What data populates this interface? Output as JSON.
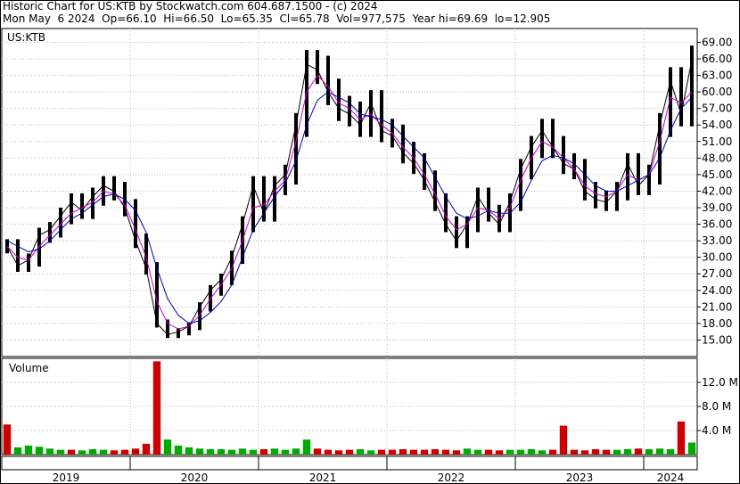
{
  "header": {
    "line1": "Historic Chart for US:KTB by Stockwatch.com 604.687.1500 - (c) 2024",
    "line2": "Mon May  6 2024  Op=66.10  Hi=66.50  Lo=65.35  Cl=65.78  Vol=977,575  Year hi=69.69  lo=12.905"
  },
  "chart_data": [
    {
      "type": "line",
      "subtype": "ohlc-price",
      "title": "US:KTB",
      "xlabel": "",
      "ylabel": "",
      "ylim": [
        12.905,
        69.69
      ],
      "y_ticks": [
        "69.00",
        "66.00",
        "63.00",
        "60.00",
        "57.00",
        "54.00",
        "51.00",
        "48.00",
        "45.00",
        "42.00",
        "39.00",
        "36.00",
        "33.00",
        "30.00",
        "27.00",
        "24.00",
        "21.00",
        "18.00",
        "15.00"
      ],
      "x_ticks": [
        "2019",
        "2020",
        "2021",
        "2022",
        "2023",
        "2024"
      ],
      "grid": true,
      "colors": {
        "price": "#000000",
        "ma_short": "#cc00cc",
        "ma_long": "#0000aa"
      },
      "x": [
        "2019-01",
        "2019-02",
        "2019-03",
        "2019-04",
        "2019-05",
        "2019-06",
        "2019-07",
        "2019-08",
        "2019-09",
        "2019-10",
        "2019-11",
        "2019-12",
        "2020-01",
        "2020-02",
        "2020-03",
        "2020-04",
        "2020-05",
        "2020-06",
        "2020-07",
        "2020-08",
        "2020-09",
        "2020-10",
        "2020-11",
        "2020-12",
        "2021-01",
        "2021-02",
        "2021-03",
        "2021-04",
        "2021-05",
        "2021-06",
        "2021-07",
        "2021-08",
        "2021-09",
        "2021-10",
        "2021-11",
        "2021-12",
        "2022-01",
        "2022-02",
        "2022-03",
        "2022-04",
        "2022-05",
        "2022-06",
        "2022-07",
        "2022-08",
        "2022-09",
        "2022-10",
        "2022-11",
        "2022-12",
        "2023-01",
        "2023-02",
        "2023-03",
        "2023-04",
        "2023-05",
        "2023-06",
        "2023-07",
        "2023-08",
        "2023-09",
        "2023-10",
        "2023-11",
        "2023-12",
        "2024-01",
        "2024-02",
        "2024-03",
        "2024-04",
        "2024-05"
      ],
      "series": [
        {
          "values": [
            32,
            28.5,
            29.5,
            34,
            35,
            37.5,
            40,
            38.5,
            41,
            43,
            42,
            39,
            33,
            28,
            18,
            16,
            16.5,
            17.5,
            21,
            24,
            26,
            30,
            36,
            43,
            38,
            43,
            45,
            54,
            65,
            64,
            60,
            57,
            56,
            54,
            58,
            53,
            52,
            49,
            47,
            44,
            40,
            36,
            33,
            36,
            41,
            38,
            36,
            40,
            46,
            50,
            53,
            50,
            47,
            46,
            42,
            40.5,
            40,
            42,
            47,
            43,
            45,
            54,
            62,
            56,
            65.78
          ]
        },
        {
          "values": [
            32,
            30,
            29.5,
            32,
            34,
            36,
            38,
            39,
            40,
            42,
            41.5,
            39.5,
            35,
            30,
            22,
            18,
            17,
            17.5,
            19.5,
            22.5,
            25,
            28,
            33,
            39,
            39.5,
            42,
            44,
            51,
            60,
            63,
            61,
            58,
            57,
            55,
            56,
            54,
            52.5,
            50,
            48,
            45,
            41.5,
            37.5,
            35,
            36,
            39,
            38.5,
            37,
            39,
            44,
            48,
            51,
            50,
            48,
            46,
            43,
            41.5,
            41,
            42,
            45,
            44,
            45,
            51,
            59,
            58,
            60
          ]
        },
        {
          "values": [
            33,
            32,
            31,
            31.5,
            33,
            35,
            37,
            38,
            39.5,
            41,
            41.5,
            40.5,
            38.5,
            34.5,
            28,
            22.5,
            19.5,
            18,
            18.5,
            20,
            22,
            25,
            30,
            35,
            38,
            41,
            43.5,
            47.5,
            54,
            58.5,
            60,
            59,
            58,
            56,
            55.5,
            55,
            54,
            52,
            50,
            48,
            44.5,
            41,
            38,
            37,
            37.5,
            38.5,
            38,
            38,
            40,
            44,
            47.5,
            48.5,
            48,
            47,
            45,
            43,
            42,
            42,
            43,
            44,
            45,
            48,
            53,
            57,
            59
          ]
        }
      ]
    },
    {
      "type": "bar",
      "title": "Volume",
      "y_ticks": [
        "12.0 M",
        "8.0 M",
        "4.0 M"
      ],
      "ylim": [
        0,
        16
      ],
      "colors": {
        "up": "#00aa00",
        "down": "#cc0000"
      },
      "x": [
        "2019-01",
        "2019-02",
        "2019-03",
        "2019-04",
        "2019-05",
        "2019-06",
        "2019-07",
        "2019-08",
        "2019-09",
        "2019-10",
        "2019-11",
        "2019-12",
        "2020-01",
        "2020-02",
        "2020-03",
        "2020-04",
        "2020-05",
        "2020-06",
        "2020-07",
        "2020-08",
        "2020-09",
        "2020-10",
        "2020-11",
        "2020-12",
        "2021-01",
        "2021-02",
        "2021-03",
        "2021-04",
        "2021-05",
        "2021-06",
        "2021-07",
        "2021-08",
        "2021-09",
        "2021-10",
        "2021-11",
        "2021-12",
        "2022-01",
        "2022-02",
        "2022-03",
        "2022-04",
        "2022-05",
        "2022-06",
        "2022-07",
        "2022-08",
        "2022-09",
        "2022-10",
        "2022-11",
        "2022-12",
        "2023-01",
        "2023-02",
        "2023-03",
        "2023-04",
        "2023-05",
        "2023-06",
        "2023-07",
        "2023-08",
        "2023-09",
        "2023-10",
        "2023-11",
        "2023-12",
        "2024-01",
        "2024-02",
        "2024-03",
        "2024-04",
        "2024-05"
      ],
      "values": [
        5,
        1.2,
        1.5,
        1.3,
        1.0,
        0.8,
        0.8,
        0.7,
        0.9,
        0.8,
        0.7,
        0.8,
        1.0,
        1.8,
        15.5,
        2.5,
        1.5,
        1.2,
        1.0,
        0.9,
        0.9,
        0.8,
        1.0,
        0.8,
        0.9,
        1.0,
        0.8,
        1.0,
        2.5,
        1.0,
        0.8,
        0.7,
        0.8,
        0.9,
        0.7,
        0.8,
        0.8,
        0.9,
        0.8,
        0.8,
        0.9,
        0.8,
        0.7,
        1.0,
        0.8,
        0.8,
        0.7,
        0.8,
        0.8,
        0.9,
        0.7,
        0.8,
        4.8,
        0.8,
        0.7,
        0.9,
        0.8,
        0.8,
        0.9,
        1.0,
        0.9,
        1.0,
        0.9,
        5.5,
        2.0
      ],
      "up": [
        false,
        true,
        true,
        true,
        true,
        true,
        false,
        true,
        true,
        true,
        false,
        false,
        false,
        false,
        false,
        true,
        true,
        true,
        true,
        true,
        true,
        true,
        true,
        true,
        false,
        true,
        true,
        true,
        true,
        false,
        false,
        false,
        false,
        true,
        true,
        false,
        false,
        false,
        false,
        false,
        false,
        false,
        false,
        true,
        true,
        false,
        false,
        true,
        true,
        true,
        true,
        false,
        false,
        false,
        false,
        false,
        false,
        true,
        true,
        false,
        true,
        true,
        true,
        false,
        true
      ]
    }
  ]
}
